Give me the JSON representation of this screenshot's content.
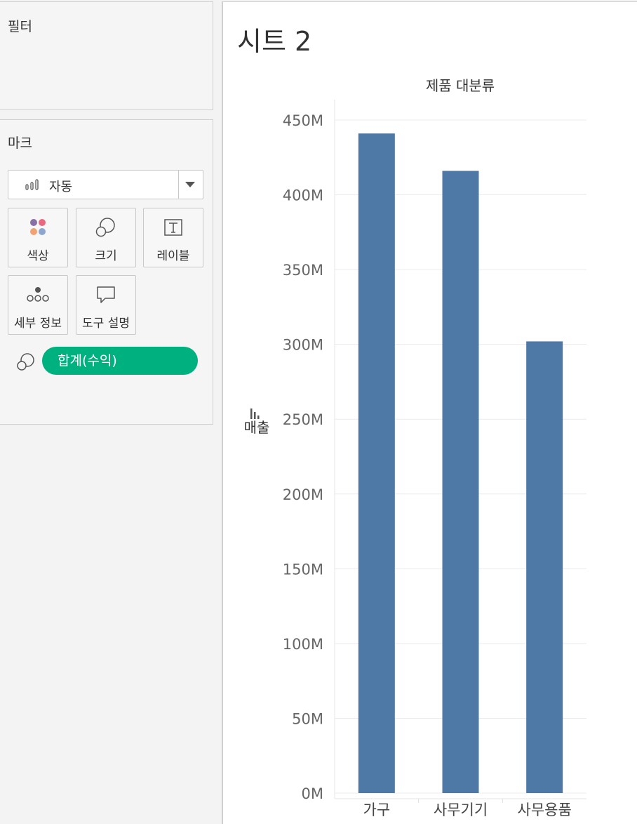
{
  "filters": {
    "title": "필터"
  },
  "marks": {
    "title": "마크",
    "mark_type": "자동",
    "buttons": {
      "color": "색상",
      "size": "크기",
      "label": "레이블",
      "detail": "세부 정보",
      "tooltip": "도구 설명"
    },
    "pill": {
      "label": "합계(수익)",
      "color": "#00b180",
      "icon": "size-icon"
    }
  },
  "sheet": {
    "title": "시트 2"
  },
  "chart_data": {
    "type": "bar",
    "title": "제품 대분류",
    "xlabel": "",
    "ylabel": "매출",
    "categories": [
      "가구",
      "사무기기",
      "사무용품"
    ],
    "values": [
      441,
      416,
      302
    ],
    "value_unit": "M",
    "ylim": [
      0,
      450
    ],
    "yticks": [
      0,
      50,
      100,
      150,
      200,
      250,
      300,
      350,
      400,
      450
    ],
    "ytick_labels": [
      "0M",
      "50M",
      "100M",
      "150M",
      "200M",
      "250M",
      "300M",
      "350M",
      "400M",
      "450M"
    ],
    "bar_color": "#4e79a7",
    "grid": true
  }
}
